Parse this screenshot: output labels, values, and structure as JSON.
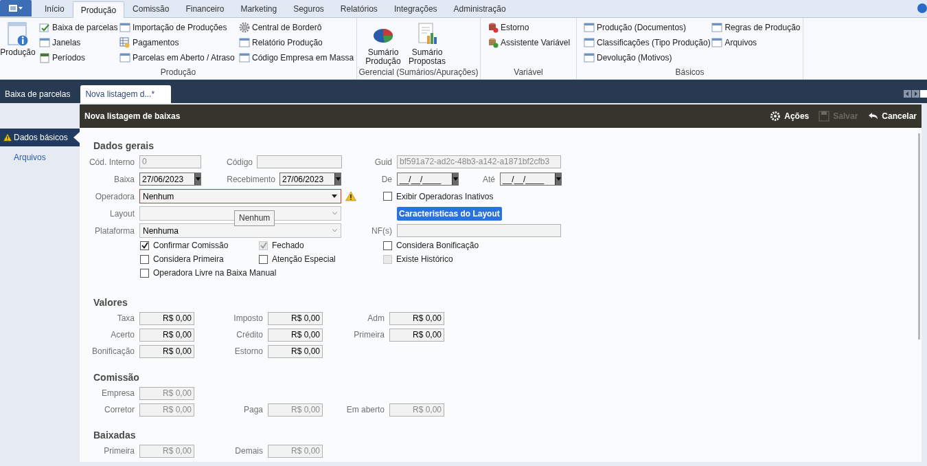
{
  "ribbon": {
    "tabs": [
      {
        "label": "Início",
        "selected": false
      },
      {
        "label": "Produção",
        "selected": true
      },
      {
        "label": "Comissão",
        "selected": false
      },
      {
        "label": "Financeiro",
        "selected": false
      },
      {
        "label": "Marketing",
        "selected": false
      },
      {
        "label": "Seguros",
        "selected": false
      },
      {
        "label": "Relatórios",
        "selected": false
      },
      {
        "label": "Integrações",
        "selected": false
      },
      {
        "label": "Administração",
        "selected": false
      }
    ],
    "groups": [
      {
        "title": "Produção",
        "large_buttons": [
          "Produção"
        ],
        "columns": [
          [
            "Baixa de parcelas",
            "Janelas",
            "Períodos"
          ],
          [
            "Importação de Produções",
            "Pagamentos",
            "Parcelas em Aberto / Atraso"
          ],
          [
            "Central de Borderô",
            "Relatório Produção",
            "Código Empresa em Massa"
          ]
        ]
      },
      {
        "title": "Gerencial (Sumários/Apurações)",
        "large_buttons": [
          "Sumário Produção",
          "Sumário Propostas"
        ]
      },
      {
        "title": "Variável",
        "columns": [
          [
            "Estorno",
            "Assistente Variável"
          ]
        ]
      },
      {
        "title": "Básicos",
        "columns": [
          [
            "Produção (Documentos)",
            "Classificações (Tipo Produção)",
            "Devolução (Motivos)"
          ],
          [
            "Regras de Produção",
            "Arquivos"
          ]
        ]
      }
    ]
  },
  "documents": {
    "tabs": [
      {
        "label": "Baixa de parcelas",
        "selected": false
      },
      {
        "label": "Nova listagem d...*",
        "selected": true
      }
    ]
  },
  "sidebar": {
    "items": [
      {
        "label": "Dados básicos",
        "selected": true,
        "warning": true
      },
      {
        "label": "Arquivos",
        "selected": false,
        "warning": false
      }
    ]
  },
  "panel": {
    "title": "Nova listagem de baixas",
    "actions": [
      {
        "label": "Ações",
        "disabled": false
      },
      {
        "label": "Salvar",
        "disabled": true
      },
      {
        "label": "Cancelar",
        "disabled": false
      }
    ]
  },
  "dados_gerais": {
    "title": "Dados gerais",
    "cod_interno": {
      "label": "Cód. Interno",
      "value": "0",
      "disabled": true
    },
    "codigo": {
      "label": "Código"
    },
    "guid": {
      "label": "Guid",
      "value": "bf591a72-ad2c-48b3-a142-a1871bf2cfb3",
      "disabled": true
    },
    "baixa": {
      "label": "Baixa",
      "value": "27/06/2023"
    },
    "recebimento": {
      "label": "Recebimento",
      "value": "27/06/2023"
    },
    "de": {
      "label": "De",
      "value": "__/__/____"
    },
    "ate": {
      "label": "Até",
      "value": "__/__/____"
    },
    "operadora": {
      "label": "Operadora",
      "value": "Nenhum",
      "invalid": true
    },
    "tooltip": "Nenhum",
    "exibir_inativos": {
      "label": "Exibir Operadoras Inativos",
      "checked": false
    },
    "layout": {
      "label": "Layout"
    },
    "layout_button": "Caracteristicas do Layout",
    "plataforma": {
      "label": "Plataforma",
      "value": "Nenhuma"
    },
    "nfs": {
      "label": "NF(s)"
    },
    "checkbox_rows": [
      [
        {
          "label": "Confirmar Comissão",
          "checked": true,
          "disabled": false
        },
        {
          "label": "Fechado",
          "checked": true,
          "disabled": true
        },
        {
          "label": "Considera Bonificação",
          "checked": false,
          "disabled": false
        }
      ],
      [
        {
          "label": "Considera Primeira",
          "checked": false,
          "disabled": false
        },
        {
          "label": "Atenção Especial",
          "checked": false,
          "disabled": false
        },
        {
          "label": "Existe Histórico",
          "checked": false,
          "disabled": true
        }
      ],
      [
        {
          "label": "Operadora Livre na Baixa Manual",
          "checked": false,
          "disabled": false
        }
      ]
    ]
  },
  "sections": [
    {
      "title": "Valores",
      "rows": [
        [
          {
            "label": "Taxa",
            "value": "R$ 0,00",
            "disabled": false
          },
          {
            "label": "Imposto",
            "value": "R$ 0,00",
            "disabled": false
          },
          {
            "label": "Adm",
            "value": "R$ 0,00",
            "disabled": false
          }
        ],
        [
          {
            "label": "Acerto",
            "value": "R$ 0,00",
            "disabled": false
          },
          {
            "label": "Crédito",
            "value": "R$ 0,00",
            "disabled": false
          },
          {
            "label": "Primeira",
            "value": "R$ 0,00",
            "disabled": false
          }
        ],
        [
          {
            "label": "Bonificação",
            "value": "R$ 0,00",
            "disabled": false
          },
          {
            "label": "Estorno",
            "value": "R$ 0,00",
            "disabled": false
          }
        ]
      ]
    },
    {
      "title": "Comissão",
      "rows": [
        [
          {
            "label": "Empresa",
            "value": "R$ 0,00",
            "disabled": true
          }
        ],
        [
          {
            "label": "Corretor",
            "value": "R$ 0,00",
            "disabled": true
          },
          {
            "label": "Paga",
            "value": "R$ 0,00",
            "disabled": true
          },
          {
            "label": "Em aberto",
            "value": "R$ 0,00",
            "disabled": true
          }
        ]
      ]
    },
    {
      "title": "Baixadas",
      "rows": [
        [
          {
            "label": "Primeira",
            "value": "R$ 0,00",
            "disabled": true
          },
          {
            "label": "Demais",
            "value": "R$ 0,00",
            "disabled": true
          }
        ]
      ]
    }
  ]
}
